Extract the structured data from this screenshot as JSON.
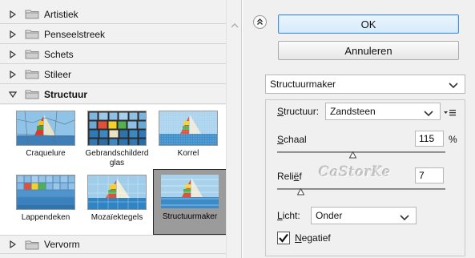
{
  "categories": [
    {
      "label": "Artistiek",
      "open": false
    },
    {
      "label": "Penseelstreek",
      "open": false
    },
    {
      "label": "Schets",
      "open": false
    },
    {
      "label": "Stileer",
      "open": false
    },
    {
      "label": "Structuur",
      "open": true
    }
  ],
  "bottom_category": {
    "label": "Vervorm",
    "open": false
  },
  "thumbnails": [
    {
      "caption": "Craquelure",
      "selected": false
    },
    {
      "caption": "Gebrandschilderd glas",
      "selected": false
    },
    {
      "caption": "Korrel",
      "selected": false
    },
    {
      "caption": "Lappendeken",
      "selected": false
    },
    {
      "caption": "Mozaïektegels",
      "selected": false
    },
    {
      "caption": "Structuurmaker",
      "selected": true
    }
  ],
  "buttons": {
    "ok": "OK",
    "cancel": "Annuleren"
  },
  "filter_select": {
    "value": "Structuurmaker"
  },
  "texture": {
    "label_pre": "",
    "label_u": "S",
    "label_post": "tructuur:",
    "value": "Zandsteen"
  },
  "scale": {
    "label_pre": "",
    "label_u": "S",
    "label_post": "chaal",
    "value": "115",
    "unit": "%",
    "slider": 0.45
  },
  "relief": {
    "label_pre": "Reli",
    "label_u": "ë",
    "label_post": "f",
    "value": "7",
    "slider": 0.14
  },
  "watermark": "CaStorKe",
  "light": {
    "label_pre": "",
    "label_u": "L",
    "label_post": "icht:",
    "value": "Onder"
  },
  "invert": {
    "label_pre": "",
    "label_u": "N",
    "label_post": "egatief",
    "checked": true
  },
  "colors": {
    "ok_border": "#4a90d9",
    "panel": "#f0f0f0",
    "thumb_selected": "#9b9b9b"
  }
}
